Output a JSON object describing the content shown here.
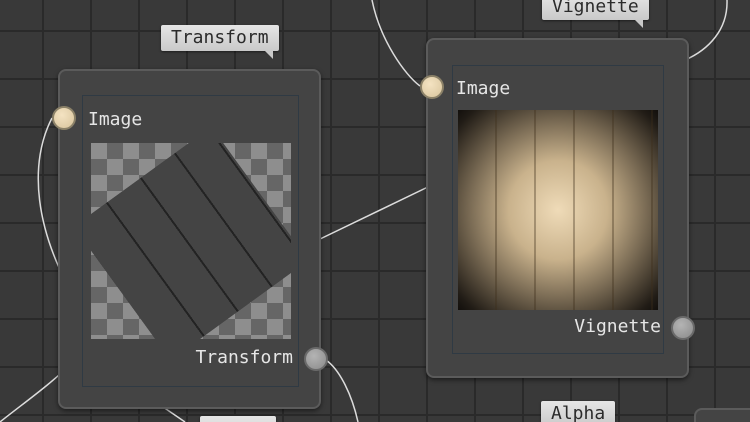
{
  "graph": {
    "nodes": {
      "transform": {
        "tag": "Transform",
        "input_label": "Image",
        "output_label": "Transform"
      },
      "vignette": {
        "tag": "Vignette",
        "input_label": "Image",
        "output_label": "Vignette"
      }
    },
    "partial_tags": {
      "alpha": "Alpha"
    }
  },
  "colors": {
    "canvas": "#393939",
    "grid": "#2a2a2a",
    "node_bg": "#444444",
    "input_port": "#e8d6b2",
    "output_port": "#a0a0a0",
    "wire": "#dcdcdc"
  }
}
